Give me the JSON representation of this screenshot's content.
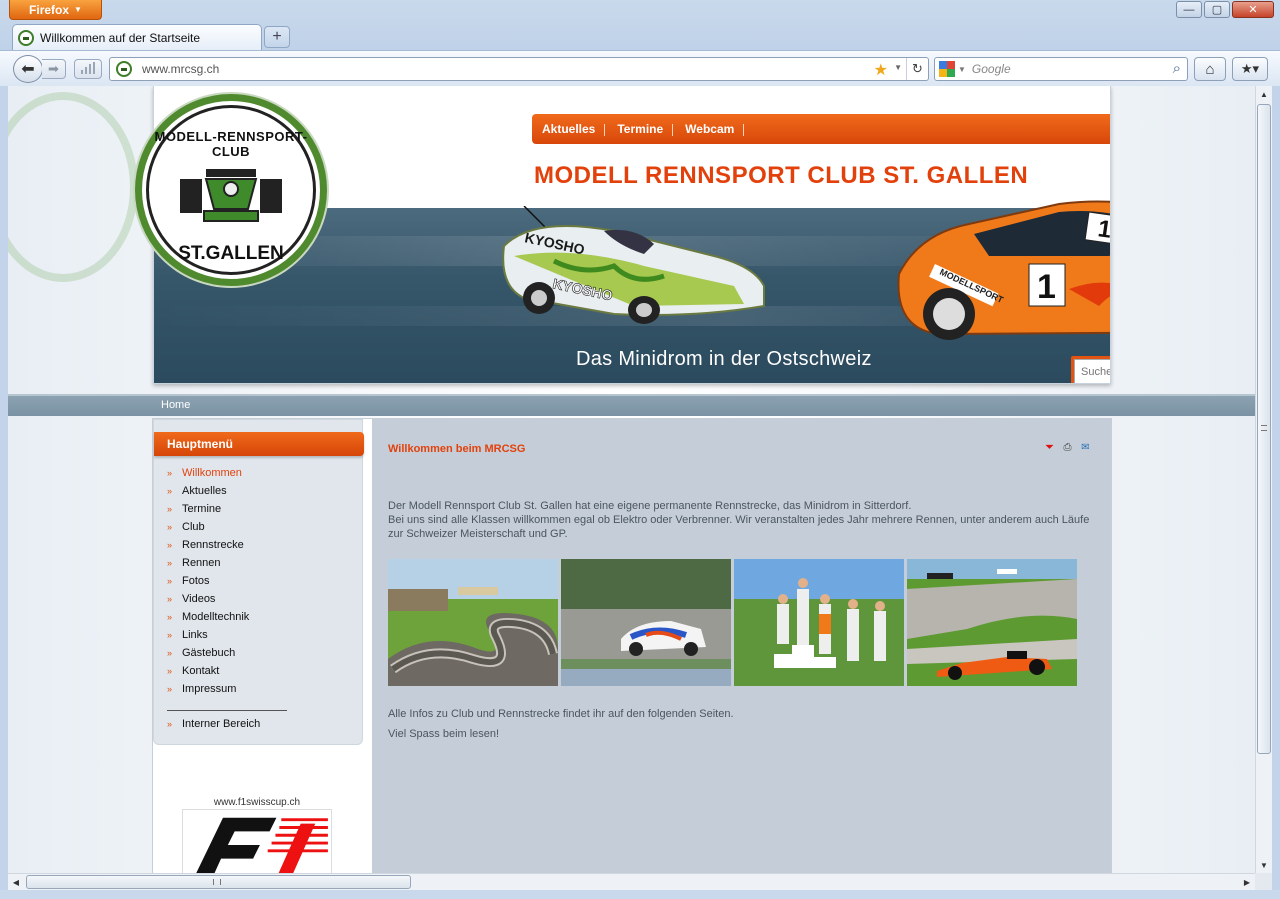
{
  "browser": {
    "app_button": "Firefox",
    "tab_title": "Willkommen auf der Startseite",
    "url": "www.mrcsg.ch",
    "search_placeholder": "Google",
    "new_tab_symbol": "+",
    "icons": [
      "firefox-menu-icon",
      "back-arrow-icon",
      "forward-arrow-icon",
      "bookmark-star-icon",
      "reload-icon",
      "google-icon",
      "magnifier-icon",
      "home-icon",
      "bookmarks-icon"
    ]
  },
  "site": {
    "logo": {
      "top_text": "MODELL-RENNSPORT-CLUB",
      "bottom_text": "ST.GALLEN"
    },
    "topnav": [
      "Aktuelles",
      "Termine",
      "Webcam"
    ],
    "title": "MODELL RENNSPORT CLUB ST. GALLEN",
    "tagline": "Das Minidrom in der Ostschweiz",
    "search_placeholder": "Suchen...",
    "breadcrumb": "Home",
    "colors": {
      "accent": "#e3410c",
      "nav_orange": "#e8560f",
      "logo_green": "#4f8a2e",
      "content_bg": "#c5ced8"
    }
  },
  "sidebar": {
    "menu_title": "Hauptmenü",
    "items": [
      "Willkommen",
      "Aktuelles",
      "Termine",
      "Club",
      "Rennstrecke",
      "Rennen",
      "Fotos",
      "Videos",
      "Modelltechnik",
      "Links",
      "Gästebuch",
      "Kontakt",
      "Impressum"
    ],
    "active": "Willkommen",
    "extra_item": "Interner Bereich",
    "bullet": "»",
    "banner_url": "www.f1swisscup.ch"
  },
  "content": {
    "title": "Willkommen beim MRCSG",
    "intro_line1": "Der Modell Rennsport Club St. Gallen hat eine eigene permanente Rennstrecke, das Minidrom in Sitterdorf.",
    "intro_line2": "Bei uns sind alle Klassen willkommen egal ob Elektro oder Verbrenner. Wir veranstalten jedes Jahr mehrere Rennen, unter anderem auch Läufe zur Schweizer Meisterschaft und GP.",
    "photos": [
      "track-aerial-photo",
      "touring-car-motion-photo",
      "podium-photo",
      "formula-cars-photo"
    ],
    "outro1": "Alle Infos zu Club und Rennstrecke findet ihr auf den folgenden Seiten.",
    "outro2": "Viel Spass beim lesen!"
  }
}
